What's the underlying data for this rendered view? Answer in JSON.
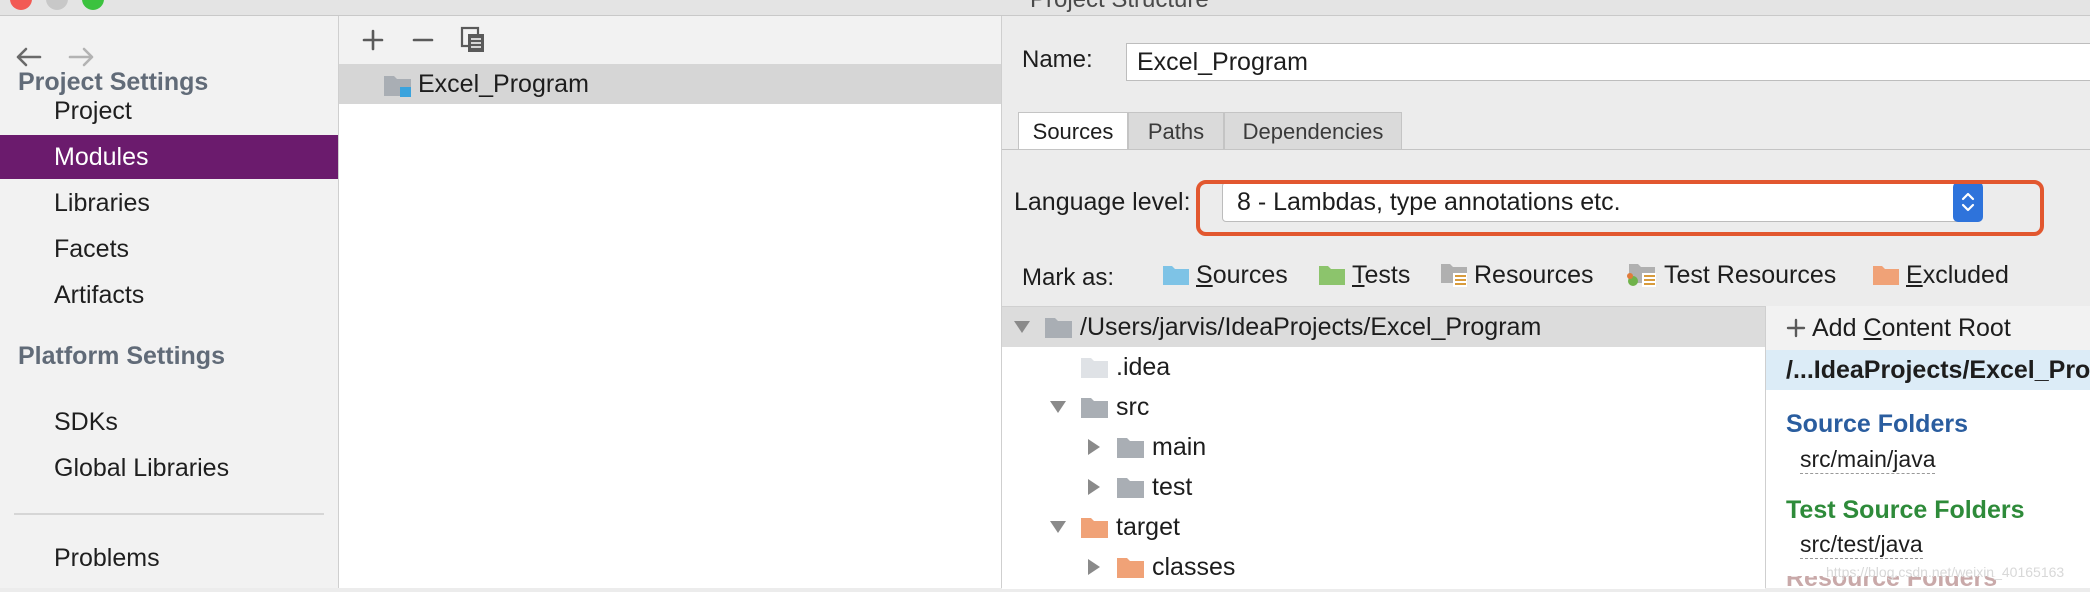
{
  "window": {
    "title": "Project Structure",
    "traffic_lights": [
      "#f25a54",
      "#c8c8c8",
      "#3cc23f"
    ]
  },
  "sidebar": {
    "sections": [
      {
        "title": "Project Settings",
        "items": [
          {
            "label": "Project",
            "selected": false
          },
          {
            "label": "Modules",
            "selected": true
          },
          {
            "label": "Libraries",
            "selected": false
          },
          {
            "label": "Facets",
            "selected": false
          },
          {
            "label": "Artifacts",
            "selected": false
          }
        ]
      },
      {
        "title": "Platform Settings",
        "items": [
          {
            "label": "SDKs",
            "selected": false
          },
          {
            "label": "Global Libraries",
            "selected": false
          }
        ]
      }
    ],
    "problems_label": "Problems",
    "selected_color": "#6b1b6d"
  },
  "modules": {
    "toolbar_icons": [
      "add-icon",
      "remove-icon",
      "copy-icon"
    ],
    "items": [
      {
        "label": "Excel_Program"
      }
    ]
  },
  "module_panel": {
    "name_label": "Name:",
    "name_value": "Excel_Program",
    "tabs": [
      {
        "label": "Sources",
        "active": true
      },
      {
        "label": "Paths",
        "active": false
      },
      {
        "label": "Dependencies",
        "active": false
      }
    ],
    "language_level": {
      "label": "Language level:",
      "value": "8 - Lambdas, type annotations etc.",
      "highlight_color": "#e2572f"
    },
    "mark_as": {
      "label": "Mark as:",
      "items": [
        {
          "mnemonic": "S",
          "rest": "ources",
          "color": "#7ec3e6"
        },
        {
          "mnemonic": "T",
          "rest": "ests",
          "color": "#8cc46c"
        },
        {
          "mnemonic": "",
          "rest": "Resources",
          "color": "#b0b0b0"
        },
        {
          "mnemonic": "",
          "rest": "Test Resources",
          "color": "#b0b0b0"
        },
        {
          "mnemonic": "E",
          "rest": "xcluded",
          "color": "#f0a277"
        }
      ]
    },
    "tree": [
      {
        "label": "/Users/jarvis/IdeaProjects/Excel_Program",
        "depth": 0,
        "expanded": true,
        "folder": "module"
      },
      {
        "label": ".idea",
        "depth": 1,
        "expanded": null,
        "folder": "light"
      },
      {
        "label": "src",
        "depth": 1,
        "expanded": true,
        "folder": "gray"
      },
      {
        "label": "main",
        "depth": 2,
        "expanded": false,
        "folder": "gray"
      },
      {
        "label": "test",
        "depth": 2,
        "expanded": false,
        "folder": "gray"
      },
      {
        "label": "target",
        "depth": 1,
        "expanded": true,
        "folder": "excluded"
      },
      {
        "label": "classes",
        "depth": 2,
        "expanded": false,
        "folder": "excluded"
      }
    ],
    "content_roots": {
      "add_prefix": "Add ",
      "add_mnemonic": "C",
      "add_rest": "ontent Root",
      "root_path": "/...IdeaProjects/Excel_Program",
      "source_folders_title": "Source Folders",
      "source_folder": "src/main/java",
      "test_folders_title": "Test Source Folders",
      "test_folder": "src/test/java",
      "resource_folders_title": "Resource Folders",
      "source_color": "#2a5d9f",
      "test_color": "#2e8b3a"
    },
    "watermark": "https://blog.csdn.net/weixin_40165163"
  }
}
